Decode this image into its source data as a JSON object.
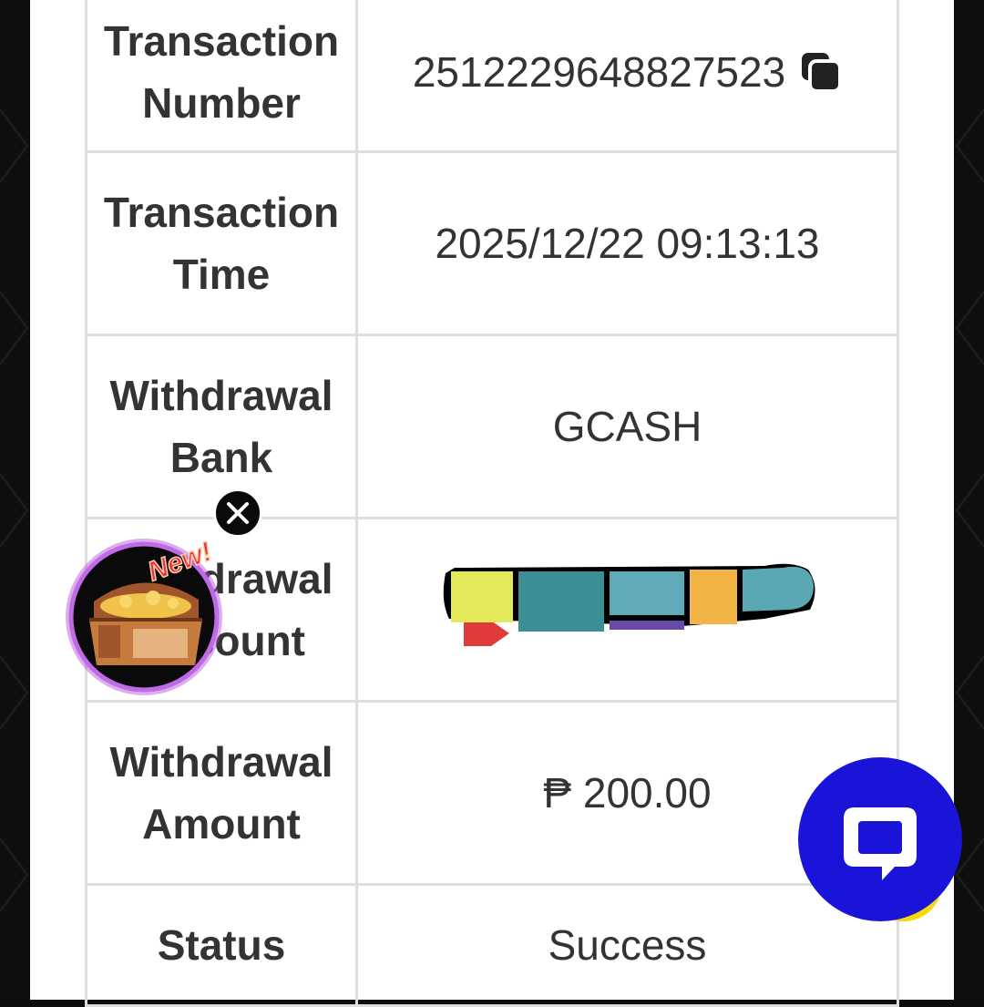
{
  "details": {
    "rows": [
      {
        "label_line1": "Transaction",
        "label_line2": "Number",
        "value": "2512229648827523"
      },
      {
        "label_line1": "Transaction",
        "label_line2": "Time",
        "value": "2025/12/22 09:13:13"
      },
      {
        "label_line1": "Withdrawal",
        "label_line2": "Bank",
        "value": "GCASH"
      },
      {
        "label_line1": "Withdrawal",
        "label_line2": "Account",
        "value": ""
      },
      {
        "label_line1": "Withdrawal",
        "label_line2": "Amount",
        "value": "₱ 200.00"
      },
      {
        "label_line1": "Status",
        "label_line2": "",
        "value": "Success"
      }
    ]
  },
  "promo": {
    "badge_text": "New!"
  },
  "icons": {
    "copy": "copy-icon",
    "close": "close-icon",
    "chat": "chat-bubble-icon",
    "treasure": "treasure-chest-icon"
  },
  "colors": {
    "chat_fab": "#1a14d8",
    "chat_fab_accent": "#f5d90a",
    "badge": "#e8323c"
  }
}
